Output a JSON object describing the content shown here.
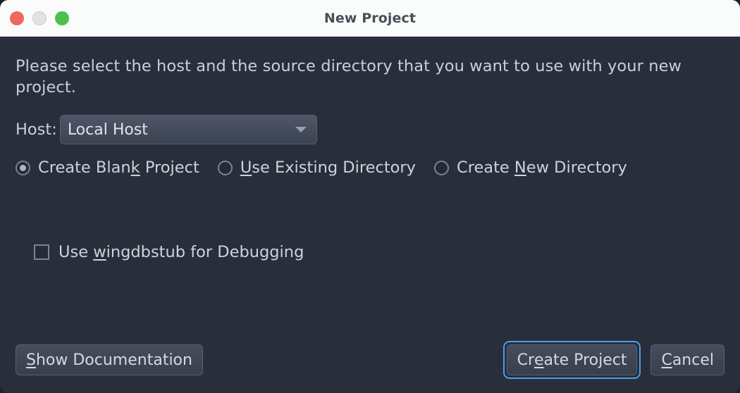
{
  "window": {
    "title": "New Project",
    "traffic_lights": [
      {
        "name": "close-button",
        "color": "#ec6a5e"
      },
      {
        "name": "minimize-button",
        "color": "#e2e2e2"
      },
      {
        "name": "zoom-button",
        "color": "#4cc14c"
      }
    ]
  },
  "main": {
    "description": "Please select the host and the source directory that you want to use with your new project.",
    "host": {
      "label": "Host:",
      "selected": "Local Host",
      "chevron": "chevron-down-icon"
    },
    "project_mode": {
      "options": [
        {
          "label_before": "Create Blan",
          "mnemonic": "k",
          "label_after": " Project",
          "checked": true
        },
        {
          "label_before": "",
          "mnemonic": "U",
          "label_after": "se Existing Directory",
          "checked": false
        },
        {
          "label_before": "Create ",
          "mnemonic": "N",
          "label_after": "ew Directory",
          "checked": false
        }
      ]
    },
    "wingdbstub": {
      "label_before": "Use ",
      "mnemonic": "w",
      "label_after": "ingdbstub for Debugging",
      "checked": false
    }
  },
  "footer": {
    "show_documentation": {
      "label_before": "",
      "mnemonic": "S",
      "label_after": "how Documentation"
    },
    "create_project": {
      "label_before": "Cr",
      "mnemonic": "e",
      "label_after": "ate Project",
      "focused": true
    },
    "cancel": {
      "label_before": "",
      "mnemonic": "C",
      "label_after": "ancel"
    }
  },
  "colors": {
    "dialog_bg": "#282e3a",
    "titlebar_bg": "#fafbfb",
    "text": "#ccd3de",
    "focus_ring": "#4a9eea"
  }
}
